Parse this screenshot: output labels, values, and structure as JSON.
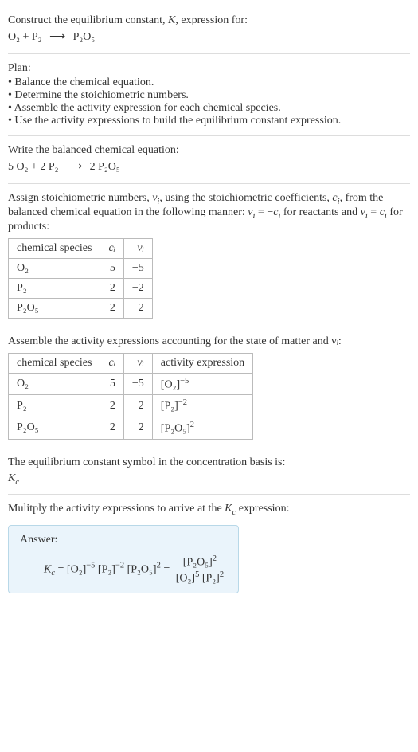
{
  "intro": {
    "line1_prefix": "Construct the equilibrium constant, ",
    "line1_k": "K",
    "line1_suffix": ", expression for:",
    "eq_lhs": "O₂ + P₂",
    "eq_arrow": "⟶",
    "eq_rhs": "P₂O₅"
  },
  "plan": {
    "title": "Plan:",
    "items": [
      "• Balance the chemical equation.",
      "• Determine the stoichiometric numbers.",
      "• Assemble the activity expression for each chemical species.",
      "• Use the activity expressions to build the equilibrium constant expression."
    ]
  },
  "balanced": {
    "title": "Write the balanced chemical equation:",
    "eq_lhs": "5 O₂ + 2 P₂",
    "eq_arrow": "⟶",
    "eq_rhs": "2 P₂O₅"
  },
  "stoich": {
    "desc_prefix": "Assign stoichiometric numbers, ",
    "desc_nu": "ν",
    "desc_i": "i",
    "desc_mid1": ", using the stoichiometric coefficients, ",
    "desc_c": "c",
    "desc_mid2": ", from the balanced chemical equation in the following manner: ",
    "desc_eq1_lhs": "ν",
    "desc_eq1_eq": " = −",
    "desc_eq1_rhs": "c",
    "desc_mid3": " for reactants and ",
    "desc_eq2": " = ",
    "desc_suffix": " for products:",
    "headers": {
      "h1": "chemical species",
      "h2": "cᵢ",
      "h3": "νᵢ"
    },
    "rows": [
      {
        "sp": "O₂",
        "c": "5",
        "nu": "−5"
      },
      {
        "sp": "P₂",
        "c": "2",
        "nu": "−2"
      },
      {
        "sp": "P₂O₅",
        "c": "2",
        "nu": "2"
      }
    ]
  },
  "activity": {
    "desc": "Assemble the activity expressions accounting for the state of matter and νᵢ:",
    "headers": {
      "h1": "chemical species",
      "h2": "cᵢ",
      "h3": "νᵢ",
      "h4": "activity expression"
    },
    "rows": [
      {
        "sp": "O₂",
        "c": "5",
        "nu": "−5",
        "act_base": "[O₂]",
        "act_exp": "−5"
      },
      {
        "sp": "P₂",
        "c": "2",
        "nu": "−2",
        "act_base": "[P₂]",
        "act_exp": "−2"
      },
      {
        "sp": "P₂O₅",
        "c": "2",
        "nu": "2",
        "act_base": "[P₂O₅]",
        "act_exp": "2"
      }
    ]
  },
  "symbol": {
    "desc": "The equilibrium constant symbol in the concentration basis is:",
    "k": "K",
    "c": "c"
  },
  "multiply": {
    "desc_prefix": "Mulitply the activity expressions to arrive at the ",
    "desc_k": "K",
    "desc_c": "c",
    "desc_suffix": " expression:"
  },
  "answer": {
    "label": "Answer:",
    "kc_k": "K",
    "kc_c": "c",
    "eq": " = ",
    "t1_base": "[O₂]",
    "t1_exp": "−5",
    "t2_base": "[P₂]",
    "t2_exp": "−2",
    "t3_base": "[P₂O₅]",
    "t3_exp": "2",
    "eq2": " = ",
    "num_base": "[P₂O₅]",
    "num_exp": "2",
    "den1_base": "[O₂]",
    "den1_exp": "5",
    "den2_base": "[P₂]",
    "den2_exp": "2"
  }
}
